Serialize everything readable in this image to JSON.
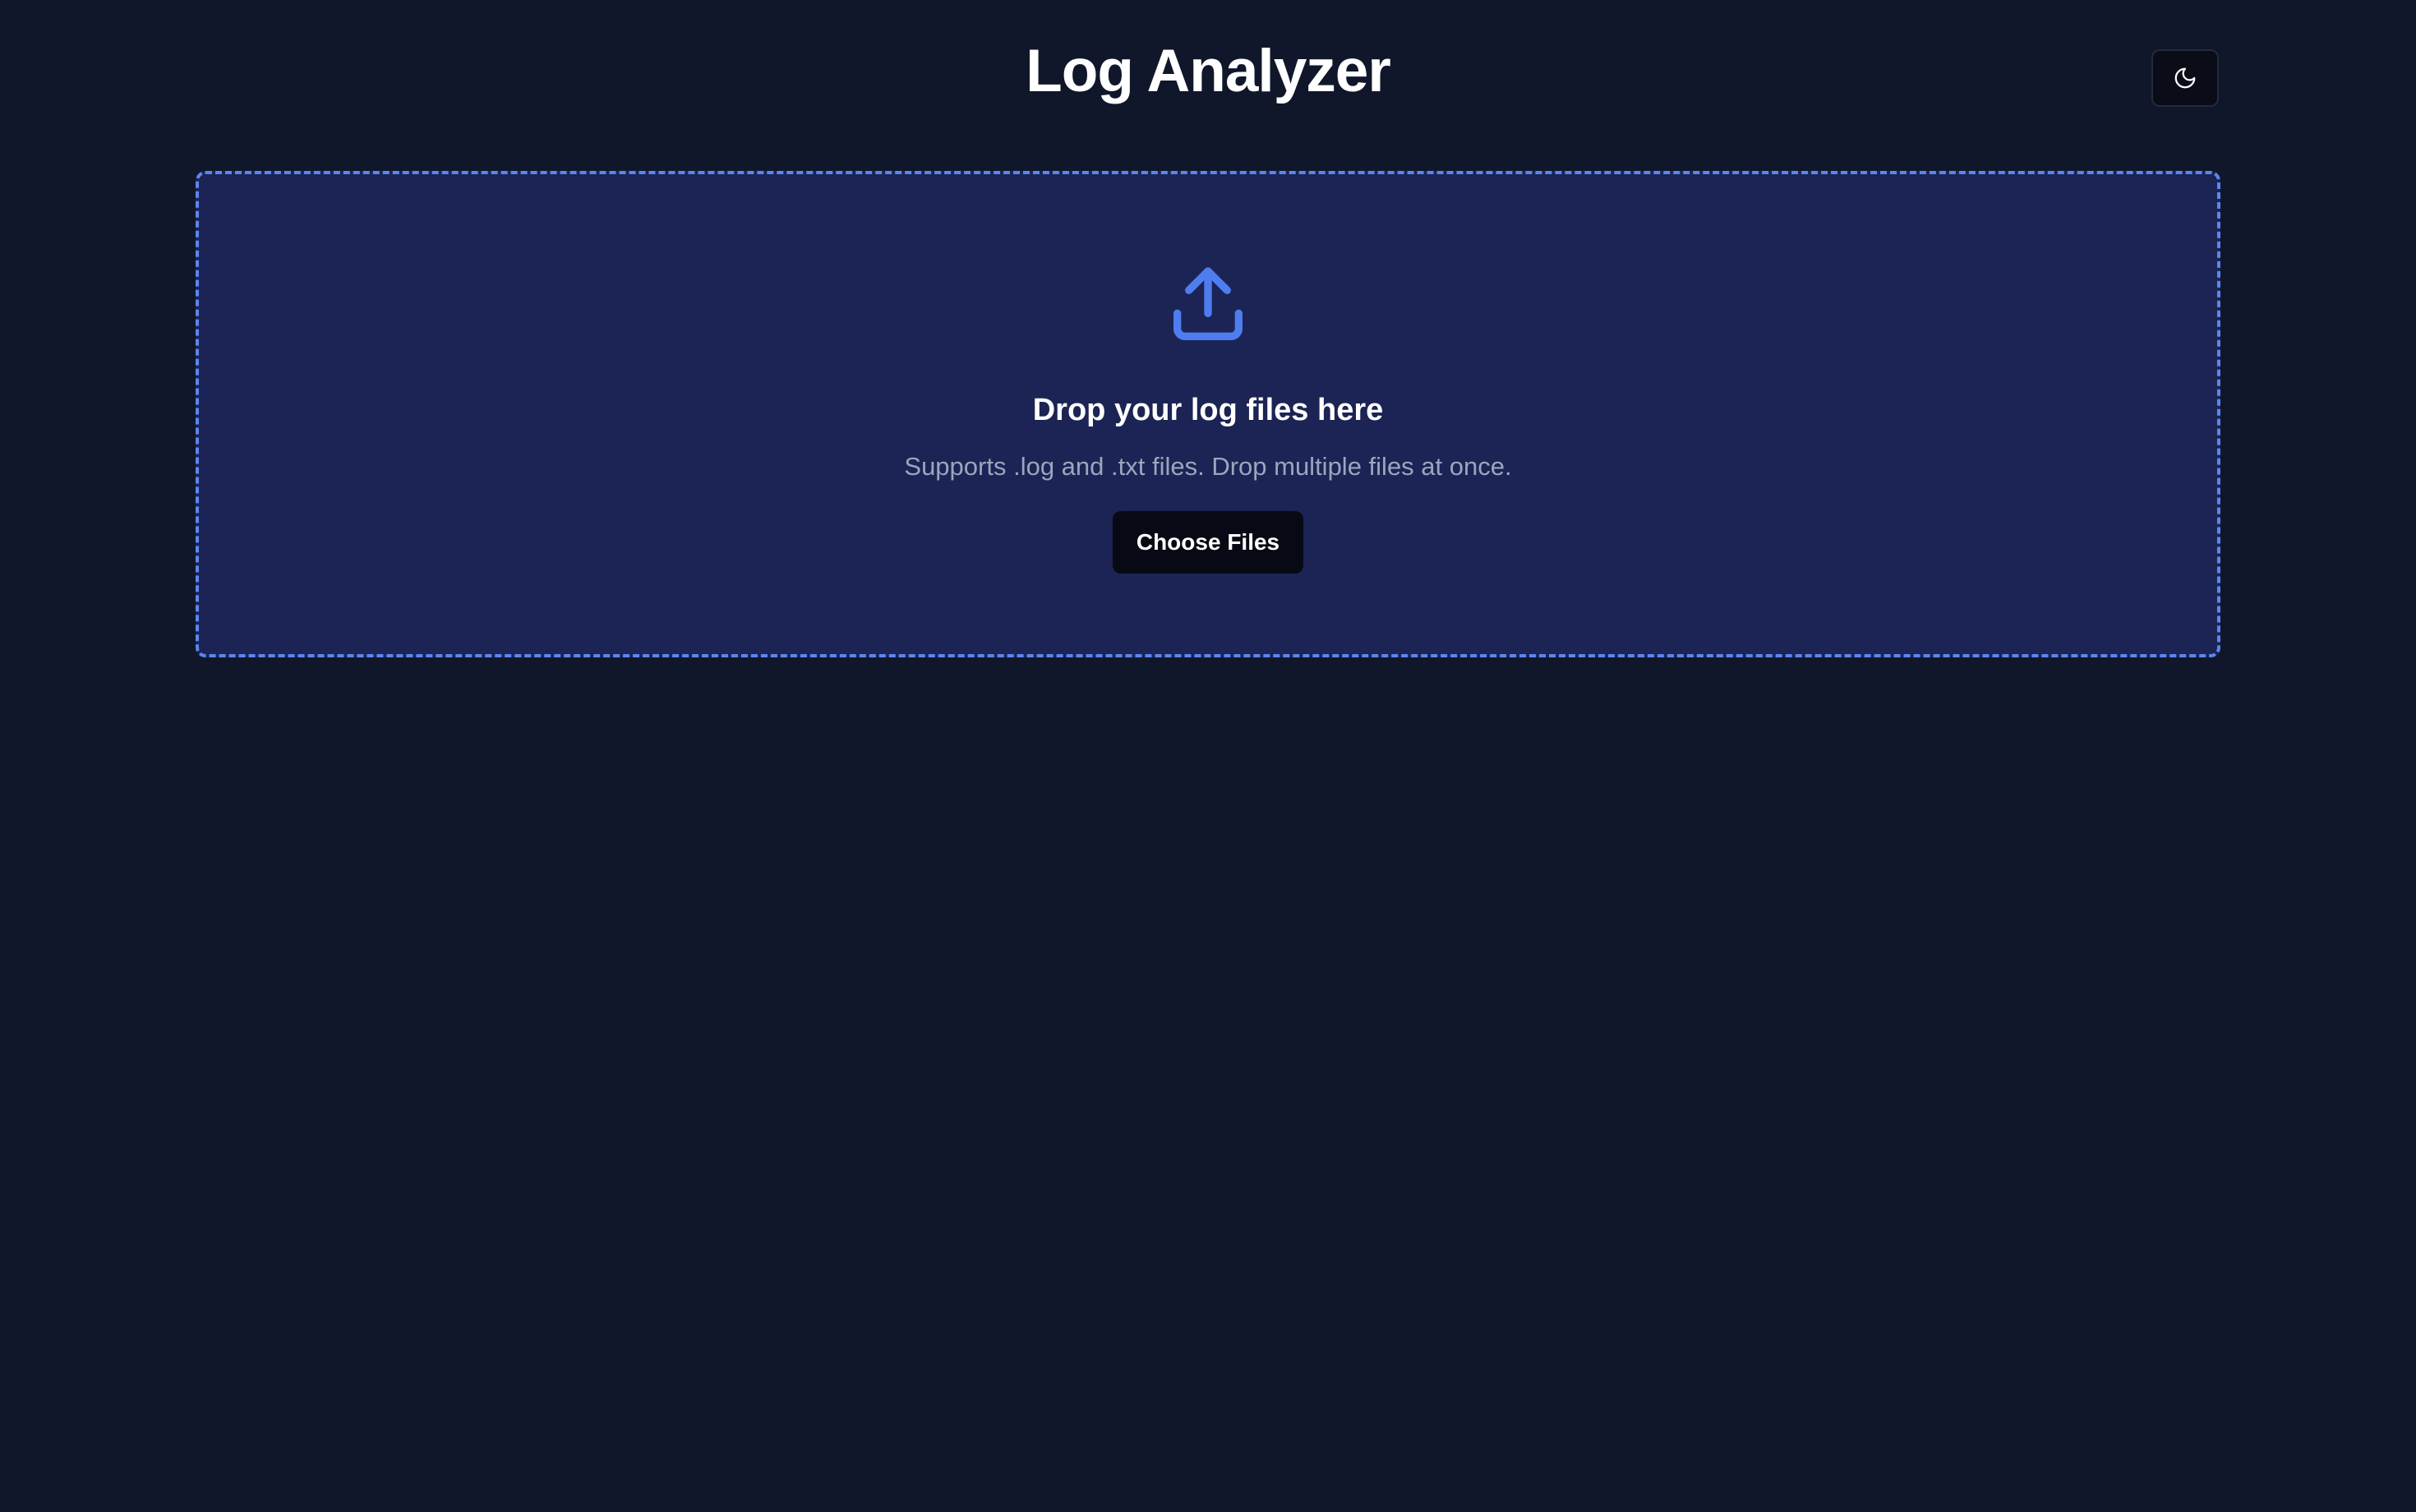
{
  "header": {
    "title": "Log Analyzer",
    "theme_toggle_icon": "moon-icon"
  },
  "dropzone": {
    "icon": "upload-icon",
    "heading": "Drop your log files here",
    "subtext": "Supports .log and .txt files. Drop multiple files at once.",
    "button_label": "Choose Files"
  },
  "colors": {
    "page_background": "#11172a",
    "dropzone_background": "#1b2454",
    "dropzone_border": "#5b86ee",
    "accent_icon": "#4f7df0",
    "button_background": "#070a14",
    "heading_text": "#ffffff",
    "muted_text": "#9aa6be"
  }
}
